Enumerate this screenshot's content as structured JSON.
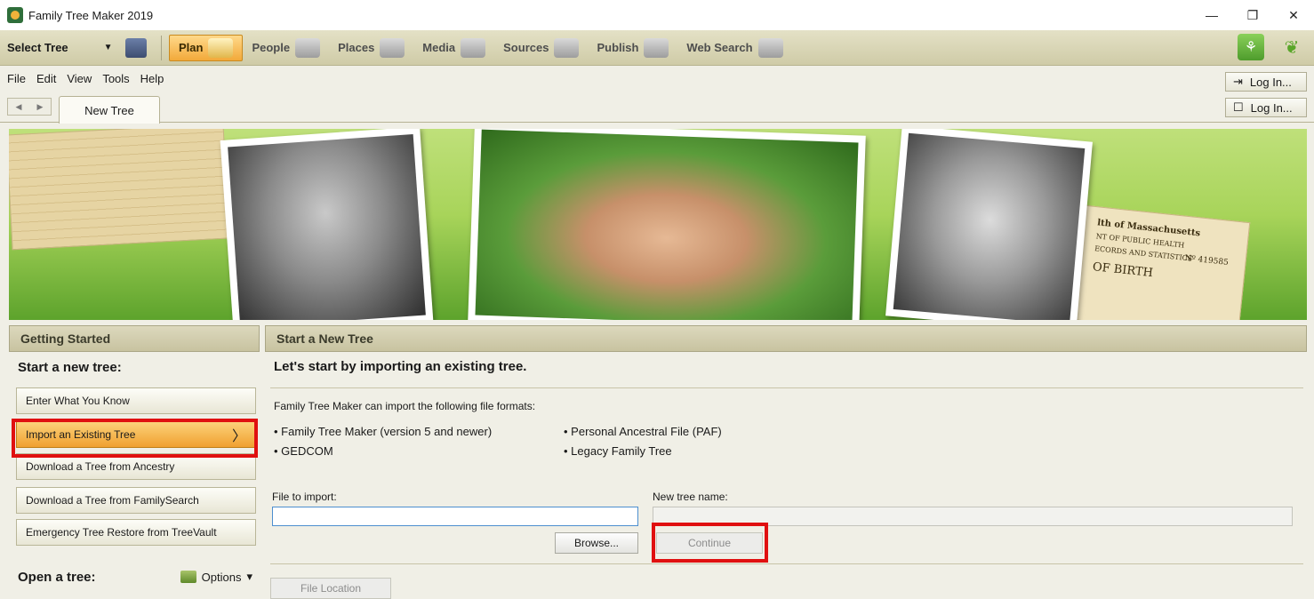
{
  "window": {
    "title": "Family Tree Maker 2019",
    "controls": {
      "minimize": "—",
      "restore": "❐",
      "close": "✕"
    }
  },
  "toolbar": {
    "select_tree": "Select Tree",
    "workspaces": [
      {
        "label": "Plan",
        "icon": "plan-icon"
      },
      {
        "label": "People",
        "icon": "people-icon"
      },
      {
        "label": "Places",
        "icon": "places-icon"
      },
      {
        "label": "Media",
        "icon": "media-icon"
      },
      {
        "label": "Sources",
        "icon": "sources-icon"
      },
      {
        "label": "Publish",
        "icon": "publish-icon"
      },
      {
        "label": "Web Search",
        "icon": "web-search-icon"
      }
    ],
    "active_workspace": "Plan"
  },
  "menu": {
    "items": [
      "File",
      "Edit",
      "View",
      "Tools",
      "Help"
    ]
  },
  "login": {
    "button1": "Log In...",
    "button2": "Log In..."
  },
  "tabs": {
    "document_tab": "New Tree"
  },
  "banner": {
    "document_text": [
      "lth of Massachusetts",
      "NT OF PUBLIC HEALTH",
      "ECORDS AND STATISTICS",
      "Nº 419585",
      "OF BIRTH"
    ]
  },
  "left_panel": {
    "header": "Getting Started",
    "start_section": "Start a new tree:",
    "buttons": [
      "Enter What You Know",
      "Import an Existing Tree",
      "Download a Tree from Ancestry",
      "Download a Tree from FamilySearch",
      "Emergency Tree Restore from TreeVault"
    ],
    "open_section": "Open a tree:",
    "options_label": "Options"
  },
  "right_panel": {
    "header": "Start a New Tree",
    "heading": "Let's start by importing an existing tree.",
    "intro": "Family Tree Maker can import the following file formats:",
    "formats_left": [
      "Family Tree Maker (version 5 and newer)",
      "GEDCOM"
    ],
    "formats_right": [
      "Personal Ancestral File (PAF)",
      "Legacy Family Tree"
    ],
    "file_label": "File to import:",
    "file_value": "",
    "name_label": "New tree name:",
    "name_value": "",
    "browse": "Browse...",
    "continue": "Continue",
    "file_location": "File Location"
  },
  "colors": {
    "toolbar_bg": "#cfcba7",
    "active_orange": "#f2a93a",
    "highlight_red": "#e01010",
    "panel_bg": "#f0efe6"
  }
}
